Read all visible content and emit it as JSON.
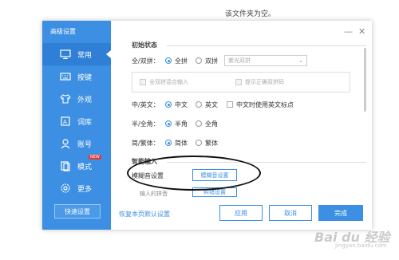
{
  "top_text": "该文件夹为空。",
  "window": {
    "title": "高级设置",
    "minimize_icon": "minimize-icon",
    "close_icon": "close-icon"
  },
  "sidebar": {
    "items": [
      {
        "label": "常用",
        "icon": "monitor-icon",
        "active": true
      },
      {
        "label": "按键",
        "icon": "keyboard-icon"
      },
      {
        "label": "外观",
        "icon": "shirt-icon"
      },
      {
        "label": "词库",
        "icon": "dictionary-icon"
      },
      {
        "label": "账号",
        "icon": "user-icon"
      },
      {
        "label": "模式",
        "icon": "mode-icon",
        "badge": "NEW"
      },
      {
        "label": "更多",
        "icon": "gear-icon"
      }
    ],
    "sync_button": "快速设置"
  },
  "initial_state": {
    "title": "初始状态",
    "full_double_label": "全/双拼：",
    "full_option": "全拼",
    "double_option": "双拼",
    "double_dropdown": "紫光双拼",
    "mixed_input": "全双拼混合输入",
    "show_correct": "提示正确双拼码",
    "cn_en_label": "中/英文：",
    "cn_option": "中文",
    "en_option": "英文",
    "en_punct": "中文时使用英文标点",
    "half_full_label": "半/全角：",
    "half_option": "半角",
    "full_width_option": "全角",
    "simp_trad_label": "简/繁体：",
    "simp_option": "简体",
    "trad_option": "繁体"
  },
  "smart_input": {
    "title": "智能输入",
    "fuzzy_label": "模糊音设置",
    "fuzzy_button": "模糊音设置",
    "partial_label": "输入的拼音",
    "partial_button": "纠错设置"
  },
  "footer": {
    "restore_link": "恢复本页默认设置",
    "apply": "应用",
    "cancel": "取消",
    "ok": "完成"
  },
  "watermark": {
    "text": "Bai du 经验",
    "sub": "jingyan.baidu.com"
  },
  "colors": {
    "accent": "#3d8fe3",
    "sidebar": "#3d8fe3",
    "new_badge": "#e23a2f"
  }
}
